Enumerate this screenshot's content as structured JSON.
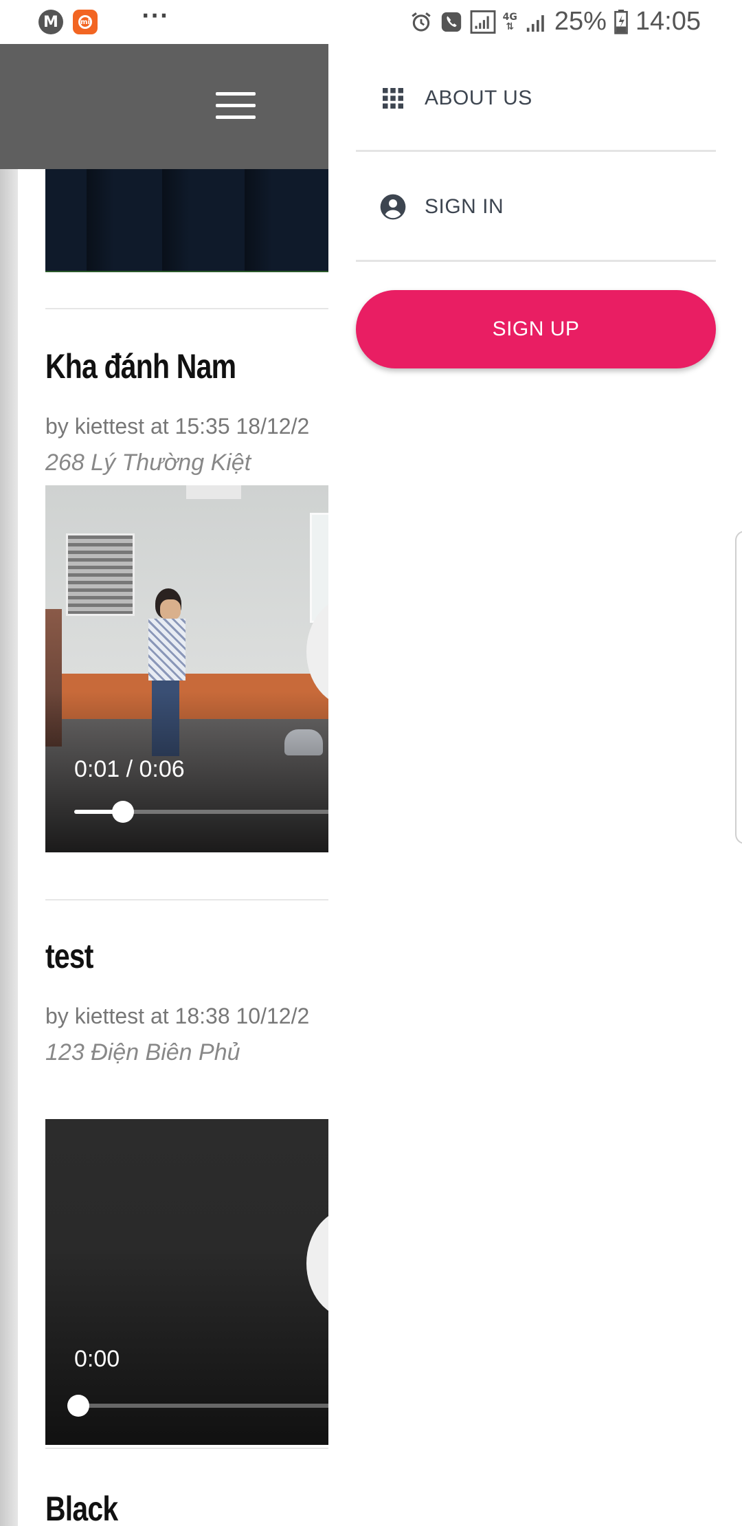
{
  "status_bar": {
    "icons_left": [
      "motorola-app-icon",
      "mi-app-icon",
      "more-notifications-icon"
    ],
    "icons_right": [
      "alarm-icon",
      "call-icon",
      "signal-icon",
      "network-4g-icon",
      "signal-icon"
    ],
    "network": "4G",
    "battery": "25%",
    "time": "14:05"
  },
  "header": {
    "menu_icon": "hamburger-icon",
    "background": "#5f5f5f"
  },
  "posts": [
    {
      "title": "Kha đánh Nam",
      "meta": "by kiettest at 15:35 18/12/2",
      "location": "268 Lý Thường Kiệt",
      "video": {
        "time_display": "0:01 / 0:06",
        "progress": 0.17
      }
    },
    {
      "title": "test",
      "meta": "by kiettest at 18:38 10/12/2",
      "location": "123 Điện Biên Phủ",
      "video": {
        "time_display": "0:00",
        "progress": 0.0
      }
    },
    {
      "title": "Black"
    }
  ],
  "drawer": {
    "items": [
      {
        "label": "ABOUT US",
        "icon": "grid-apps-icon"
      },
      {
        "label": "SIGN IN",
        "icon": "account-circle-icon"
      }
    ],
    "signup_label": "SIGN UP",
    "accent": "#e91e63"
  }
}
